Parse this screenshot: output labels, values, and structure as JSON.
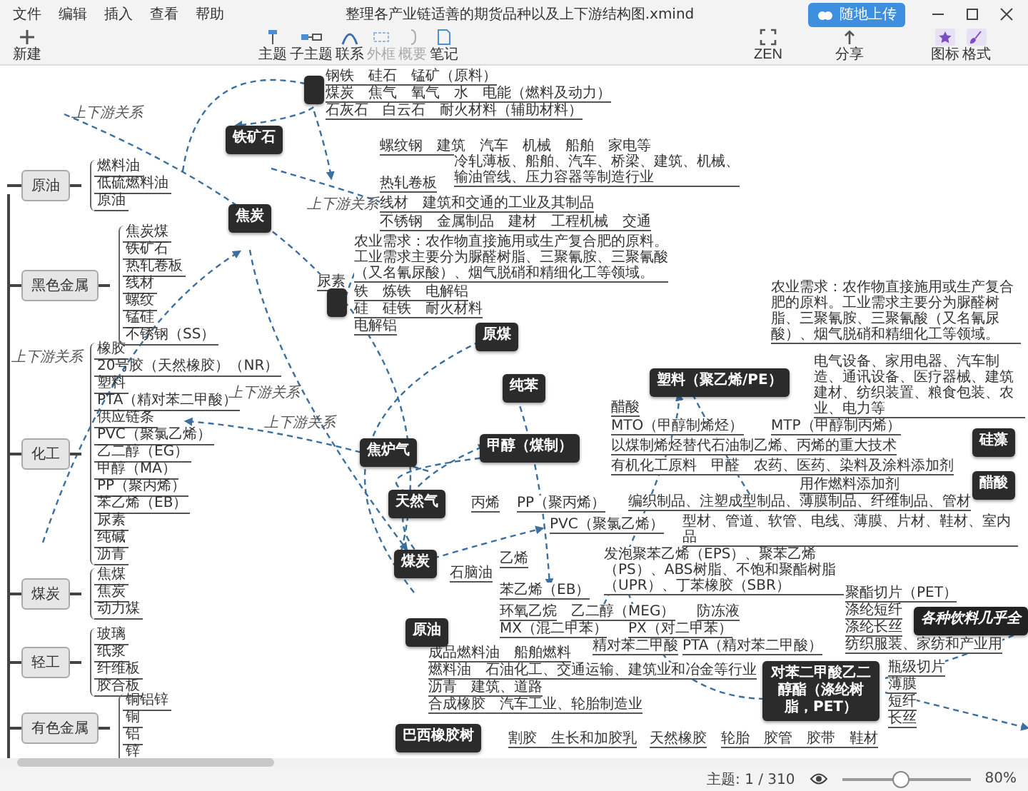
{
  "menu": [
    "文件",
    "编辑",
    "插入",
    "查看",
    "帮助"
  ],
  "window": {
    "title": "整理各产业链适善的期货品种以及上下游结构图.xmind"
  },
  "upload_button": {
    "label": "随地上传"
  },
  "toolbar": [
    {
      "kind": "new",
      "label": "新建",
      "disabled": false
    },
    {
      "kind": "topic",
      "label": "主题",
      "disabled": false
    },
    {
      "kind": "subtopic",
      "label": "子主题",
      "disabled": false
    },
    {
      "kind": "relation",
      "label": "联系",
      "disabled": false
    },
    {
      "kind": "boundary",
      "label": "外框",
      "disabled": true
    },
    {
      "kind": "summary",
      "label": "概要",
      "disabled": true
    },
    {
      "kind": "note",
      "label": "笔记",
      "disabled": false
    },
    {
      "kind": "zen",
      "label": "ZEN",
      "disabled": false
    },
    {
      "kind": "share",
      "label": "分享",
      "disabled": false
    },
    {
      "kind": "icon",
      "label": "图标",
      "disabled": false
    },
    {
      "kind": "format",
      "label": "格式",
      "disabled": false
    }
  ],
  "categories": [
    {
      "label": "原油",
      "children": [
        "燃料油",
        "低硫燃料油",
        "原油"
      ]
    },
    {
      "label": "黑色金属",
      "children": [
        "焦炭煤",
        "铁矿石",
        "热轧卷板",
        "线材",
        "螺纹",
        "锰硅",
        "不锈钢（SS）"
      ]
    },
    {
      "label": "化工",
      "children": [
        "橡胶",
        "20号胶（天然橡胶）（NR）",
        "塑料",
        "PTA（精对苯二甲酸）",
        "供应链条",
        "PVC（聚氯乙烯）",
        "乙二醇（EG）",
        "甲醇（MA）",
        "PP（聚丙烯）",
        "苯乙烯（EB）",
        "尿素",
        "纯碱",
        "沥青"
      ]
    },
    {
      "label": "煤炭",
      "children": [
        "焦煤",
        "焦炭",
        "动力煤"
      ]
    },
    {
      "label": "轻工",
      "children": [
        "玻璃",
        "纸浆",
        "纤维板",
        "胶合板"
      ]
    },
    {
      "label": "有色金属",
      "children": [
        "铜铝锌",
        "铜",
        "铝",
        "锌"
      ]
    }
  ],
  "relation_labels": [
    "上下游关系",
    "上下游关系",
    "上下游关系",
    "上下游关系",
    "上下游关系"
  ],
  "nodes": [
    {
      "kind": "dark"
    },
    {
      "kind": "dark",
      "label": "铁矿石"
    },
    {
      "kind": "dark",
      "label": "焦炭"
    },
    {
      "kind": "dark"
    },
    {
      "kind": "dark",
      "label": "原煤"
    },
    {
      "kind": "dark",
      "label": "纯苯"
    },
    {
      "kind": "dark",
      "label": "焦炉气"
    },
    {
      "kind": "dark",
      "label": "甲醇（煤制）"
    },
    {
      "kind": "dark",
      "label": "塑料（聚乙烯/PE）"
    },
    {
      "kind": "dark",
      "label": "天然气"
    },
    {
      "kind": "dark",
      "label": "煤炭"
    },
    {
      "kind": "dark",
      "label": "原油"
    },
    {
      "kind": "dark",
      "label": "巴西橡胶树"
    },
    {
      "kind": "dark",
      "label": "对苯二甲酸乙二醇酯（涤纶树脂，PET）"
    },
    {
      "kind": "dark",
      "label": "硅藻"
    },
    {
      "kind": "dark",
      "label": "醋酸"
    },
    {
      "kind": "note",
      "label": "各种饮料几乎全"
    }
  ],
  "branches": [
    "钢铁　硅石　锰矿（原料）",
    "煤炭　焦气　氧气　水　电能（燃料及动力）",
    "石灰石　白云石　耐火材料（辅助材料）",
    "螺纹钢　建筑　汽车　机械　船舶　家电等",
    "热轧卷板",
    "冷轧薄板、船舶、汽车、桥梁、建筑、机械、输油管线、压力容器等制造行业",
    "线材　建筑和交通的工业及其制品",
    "不锈钢　金属制品　建材　工程机械　交通",
    "农业需求：农作物直接施用或生产复合肥的原料。工业需求主要分为脲醛树脂、三聚氰胺、三聚氰酸（又名氰尿酸）、烟气脱硝和精细化工等领域。",
    "尿素",
    "铁　炼铁　电解铝",
    "硅　硅铁　耐火材料",
    "电解铝",
    "农业需求：农作物直接施用或生产复合肥的原料。工业需求主要分为脲醛树脂、三聚氰胺、三聚氰酸（又名氰尿酸）、烟气脱硝和精细化工等领域。",
    "醋酸",
    "电气设备、家用电器、汽车制造、通讯设备、医疗器械、建筑建材、纺织装置、粮食包装、农业、电力等",
    "MTO（甲醇制烯烃）",
    "MTP（甲醇制丙烯）",
    "以煤制烯烃替代石油制乙烯、丙烯的重大技术",
    "有机化工原料　甲醛　农药、医药、染料及涂料添加剂",
    "用作燃料添加剂",
    "丙烯",
    "PP（聚丙烯）",
    "编织制品、注塑成型制品、薄膜制品、纤维制品、管材",
    "PVC（聚氯乙烯）",
    "型材、管道、软管、电线、薄膜、片材、鞋材、室内品",
    "石脑油",
    "乙烯",
    "苯乙烯（EB）",
    "发泡聚苯乙烯（EPS）、聚苯乙烯（PS）、ABS树脂、不饱和聚酯树脂（UPR）、丁苯橡胶（SBR）",
    "环氧乙烷",
    "乙二醇（MEG）",
    "防冻液",
    "MX（混二甲苯）",
    "PX（对二甲苯）",
    "精对苯二甲酸",
    "PTA（精对苯二甲酸）",
    "成品燃料油　船舶燃料",
    "燃料油　石油化工、交通运输、建筑业和冶金等行业",
    "沥青　建筑、道路",
    "合成橡胶　汽车工业、轮胎制造业",
    "割胶　生长和加胶乳",
    "天然橡胶",
    "轮胎　胶管　胶带　鞋材",
    "聚酯切片（PET）",
    "涤纶短纤",
    "涤纶长丝",
    "纺织服装、家纺和产业用",
    "瓶级切片",
    "薄膜",
    "短纤",
    "长丝"
  ],
  "status_bar": {
    "topic_count": "主题: 1 / 310",
    "zoom": {
      "level": 0.45,
      "reading": "80%"
    }
  }
}
